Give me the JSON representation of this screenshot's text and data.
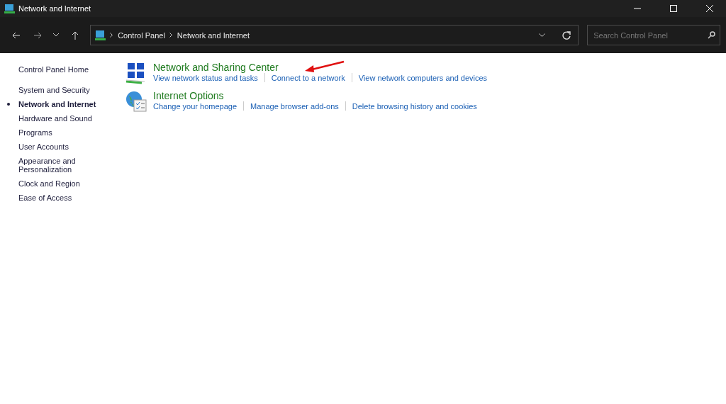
{
  "window": {
    "title": "Network and Internet"
  },
  "address_bar": {
    "path": [
      "Control Panel",
      "Network and Internet"
    ]
  },
  "search": {
    "placeholder": "Search Control Panel"
  },
  "sidebar": {
    "home": "Control Panel Home",
    "items": [
      {
        "label": "System and Security",
        "selected": false
      },
      {
        "label": "Network and Internet",
        "selected": true
      },
      {
        "label": "Hardware and Sound",
        "selected": false
      },
      {
        "label": "Programs",
        "selected": false
      },
      {
        "label": "User Accounts",
        "selected": false
      },
      {
        "label": "Appearance and Personalization",
        "selected": false
      },
      {
        "label": "Clock and Region",
        "selected": false
      },
      {
        "label": "Ease of Access",
        "selected": false
      }
    ]
  },
  "categories": [
    {
      "kind": "network",
      "title": "Network and Sharing Center",
      "links": [
        "View network status and tasks",
        "Connect to a network",
        "View network computers and devices"
      ]
    },
    {
      "kind": "internet",
      "title": "Internet Options",
      "links": [
        "Change your homepage",
        "Manage browser add-ons",
        "Delete browsing history and cookies"
      ]
    }
  ]
}
